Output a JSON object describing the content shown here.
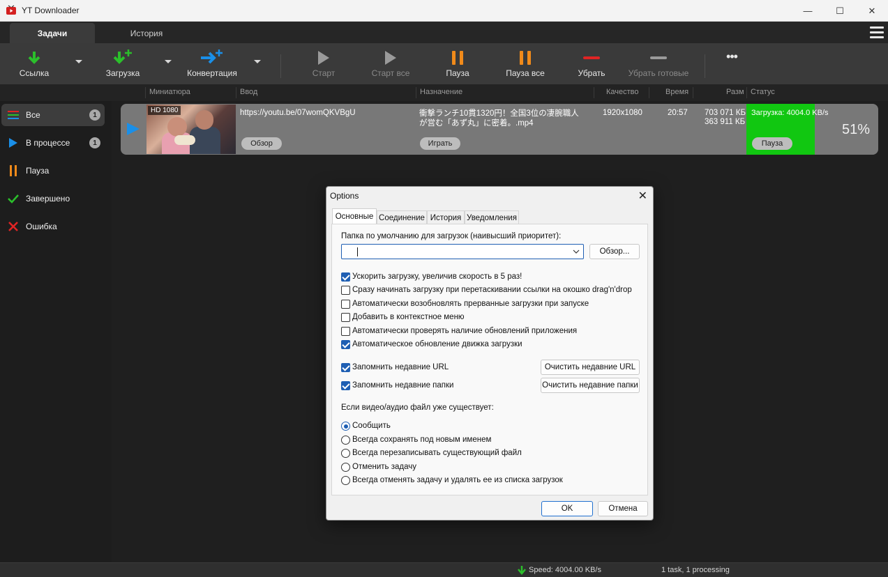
{
  "window": {
    "title": "YT Downloader",
    "minimize_glyph": "—",
    "maximize_glyph": "☐",
    "close_glyph": "✕"
  },
  "tabs": [
    {
      "label": "Задачи",
      "active": true
    },
    {
      "label": "История",
      "active": false
    }
  ],
  "toolbar": {
    "link": "Ссылка",
    "download": "Загрузка",
    "convert": "Конвертация",
    "start": "Старт",
    "start_all": "Старт все",
    "pause": "Пауза",
    "pause_all": "Пауза все",
    "remove": "Убрать",
    "remove_done": "Убрать готовые",
    "more_glyph": "•••"
  },
  "columns": {
    "thumbnail": "Миниатюра",
    "input": "Ввод",
    "destination": "Назначение",
    "quality": "Качество",
    "time": "Время",
    "size": "Разм",
    "status": "Статус"
  },
  "sidebar": {
    "items": [
      {
        "label": "Все",
        "count": "1",
        "icon": "list-icon"
      },
      {
        "label": "В процессе",
        "count": "1",
        "icon": "play-icon"
      },
      {
        "label": "Пауза",
        "icon": "pause-icon"
      },
      {
        "label": "Завершено",
        "icon": "check-icon"
      },
      {
        "label": "Ошибка",
        "icon": "x-icon"
      }
    ]
  },
  "download": {
    "thumbnail_badge": "HD 1080",
    "url": "https://youtu.be/07womQKVBgU",
    "browse_label": "Обзор",
    "destination_line1": "衝撃ランチ10貫1320円！全国3位の凄腕職人",
    "destination_line2": "が営む「あず丸」に密着。.mp4",
    "play_label": "Играть",
    "quality": "1920x1080",
    "time": "20:57",
    "size_total": "703 071 КБ",
    "size_done": "363 911 КБ",
    "status_text": "Загрузка: 4004.0 KB/s",
    "pause_label": "Пауза",
    "percent": "51%",
    "progress": 0.51
  },
  "statusbar": {
    "speed": "Speed: 4004.00 KB/s",
    "tasks": "1 task, 1 processing"
  },
  "dialog": {
    "title": "Options",
    "close_glyph": "✕",
    "tabs": [
      "Основные",
      "Соединение",
      "История",
      "Уведомления"
    ],
    "default_folder_label": "Папка по умолчанию для загрузок (наивысший приоритет):",
    "folder_value": "",
    "browse_button": "Обзор...",
    "checkboxes": [
      {
        "label": "Ускорить загрузку, увеличив скорость в 5 раз!",
        "checked": true
      },
      {
        "label": "Сразу начинать загрузку при перетаскивании ссылки на окошко drag'n'drop",
        "checked": false
      },
      {
        "label": "Автоматически возобновлять прерванные загрузки при запуске",
        "checked": false
      },
      {
        "label": "Добавить в контекстное меню",
        "checked": false
      },
      {
        "label": "Автоматически проверять наличие обновлений приложения",
        "checked": false
      },
      {
        "label": "Автоматическое обновление движка загрузки",
        "checked": true
      }
    ],
    "remember_url": {
      "label": "Запомнить недавние URL",
      "checked": true
    },
    "clear_url_button": "Очистить недавние URL",
    "remember_folders": {
      "label": "Запомнить недавние папки",
      "checked": true
    },
    "clear_folders_button": "Очистить недавние папки",
    "exists_label": "Если видео/аудио файл уже существует:",
    "radios": [
      {
        "label": "Сообщить",
        "selected": true
      },
      {
        "label": "Всегда сохранять под новым именем",
        "selected": false
      },
      {
        "label": "Всегда перезаписывать существующий файл",
        "selected": false
      },
      {
        "label": "Отменить задачу",
        "selected": false
      },
      {
        "label": "Всегда отменять задачу и удалять ее из списка загрузок",
        "selected": false
      }
    ],
    "ok_button": "OK",
    "cancel_button": "Отмена"
  },
  "colors": {
    "accent": "#1f5fb3",
    "progress_green": "#11c711",
    "download_green": "#2bbf2b",
    "convert_blue": "#1a8fe8",
    "pause_orange": "#f08a1a",
    "remove_red": "#e02424"
  }
}
